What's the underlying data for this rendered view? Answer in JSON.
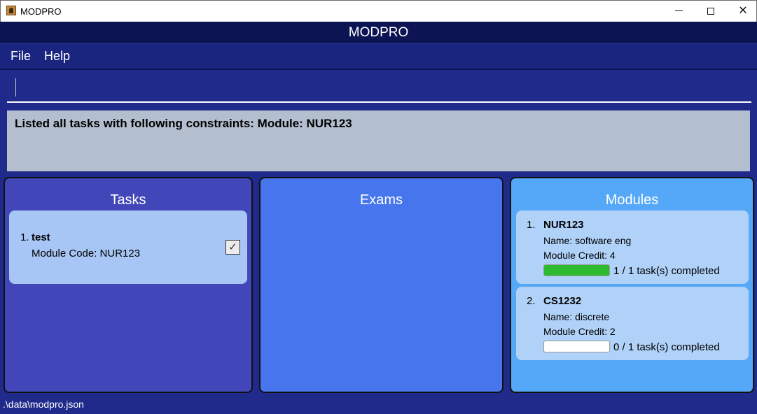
{
  "window": {
    "title": "MODPRO",
    "icon": "java-cup-icon",
    "minimize_icon": "minimize-icon",
    "maximize_icon": "maximize-icon",
    "close_glyph": "✕"
  },
  "header": {
    "title": "MODPRO"
  },
  "menu": {
    "file": "File",
    "help": "Help"
  },
  "command": {
    "value": "",
    "placeholder": ""
  },
  "result": {
    "message": "Listed all tasks with following constraints: Module: NUR123"
  },
  "panels": {
    "tasks": {
      "title": "Tasks",
      "items": [
        {
          "index": "1.",
          "name": "test",
          "module_line": "Module Code: NUR123",
          "done": true,
          "check_glyph": "✓"
        }
      ]
    },
    "exams": {
      "title": "Exams",
      "items": []
    },
    "modules": {
      "title": "Modules",
      "items": [
        {
          "index": "1.",
          "code": "NUR123",
          "name_line": "Name: software eng",
          "credit_line": "Module Credit: 4",
          "progress": 1.0,
          "progress_text": "1 / 1 task(s) completed"
        },
        {
          "index": "2.",
          "code": "CS1232",
          "name_line": "Name: discrete",
          "credit_line": "Module Credit: 2",
          "progress": 0.0,
          "progress_text": "0 / 1 task(s) completed"
        }
      ]
    }
  },
  "status": {
    "path": ".\\data\\modpro.json"
  },
  "colors": {
    "tasks_panel": "#4146b8",
    "exams_panel": "#4675ee",
    "modules_panel": "#55a8f7",
    "progress_fill": "#2fbb2f"
  }
}
